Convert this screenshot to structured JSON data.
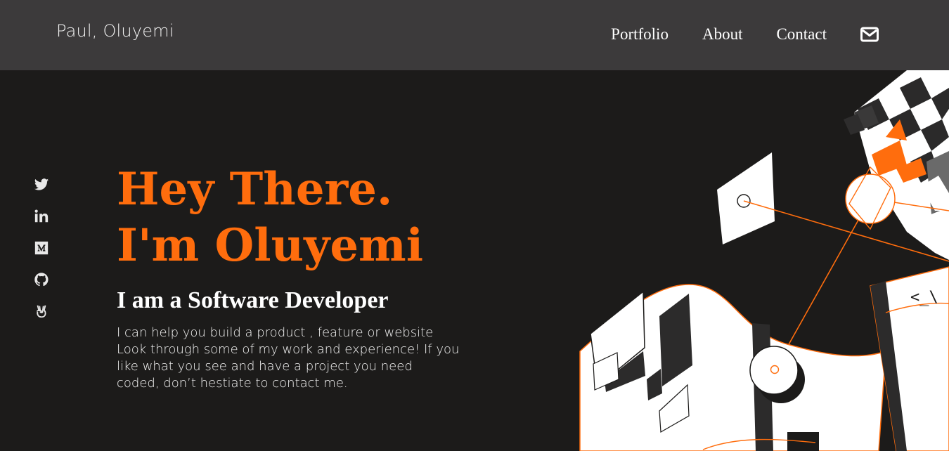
{
  "header": {
    "brand": "Paul, Oluyemi",
    "nav": [
      {
        "label": "Portfolio"
      },
      {
        "label": "About"
      },
      {
        "label": "Contact"
      }
    ],
    "mail_icon": "envelope-icon"
  },
  "socials": [
    {
      "icon": "twitter-icon"
    },
    {
      "icon": "linkedin-icon"
    },
    {
      "icon": "medium-icon"
    },
    {
      "icon": "github-icon"
    },
    {
      "icon": "angellist-icon"
    }
  ],
  "hero": {
    "title_line1": "Hey There.",
    "title_line2": "I'm Oluyemi",
    "subtitle": "I am a Software Developer",
    "description_lines": [
      "I can help you build a product , feature or website",
      "Look through some of my work and experience! If you",
      "like what you see and have a project you need",
      "coded, don’t hestiate to contact me."
    ]
  },
  "illustration": {
    "code_text": "<_\\"
  },
  "colors": {
    "accent": "#ff6d0d",
    "header_bg": "#3c3a3b",
    "page_bg": "#1c1b1a"
  }
}
